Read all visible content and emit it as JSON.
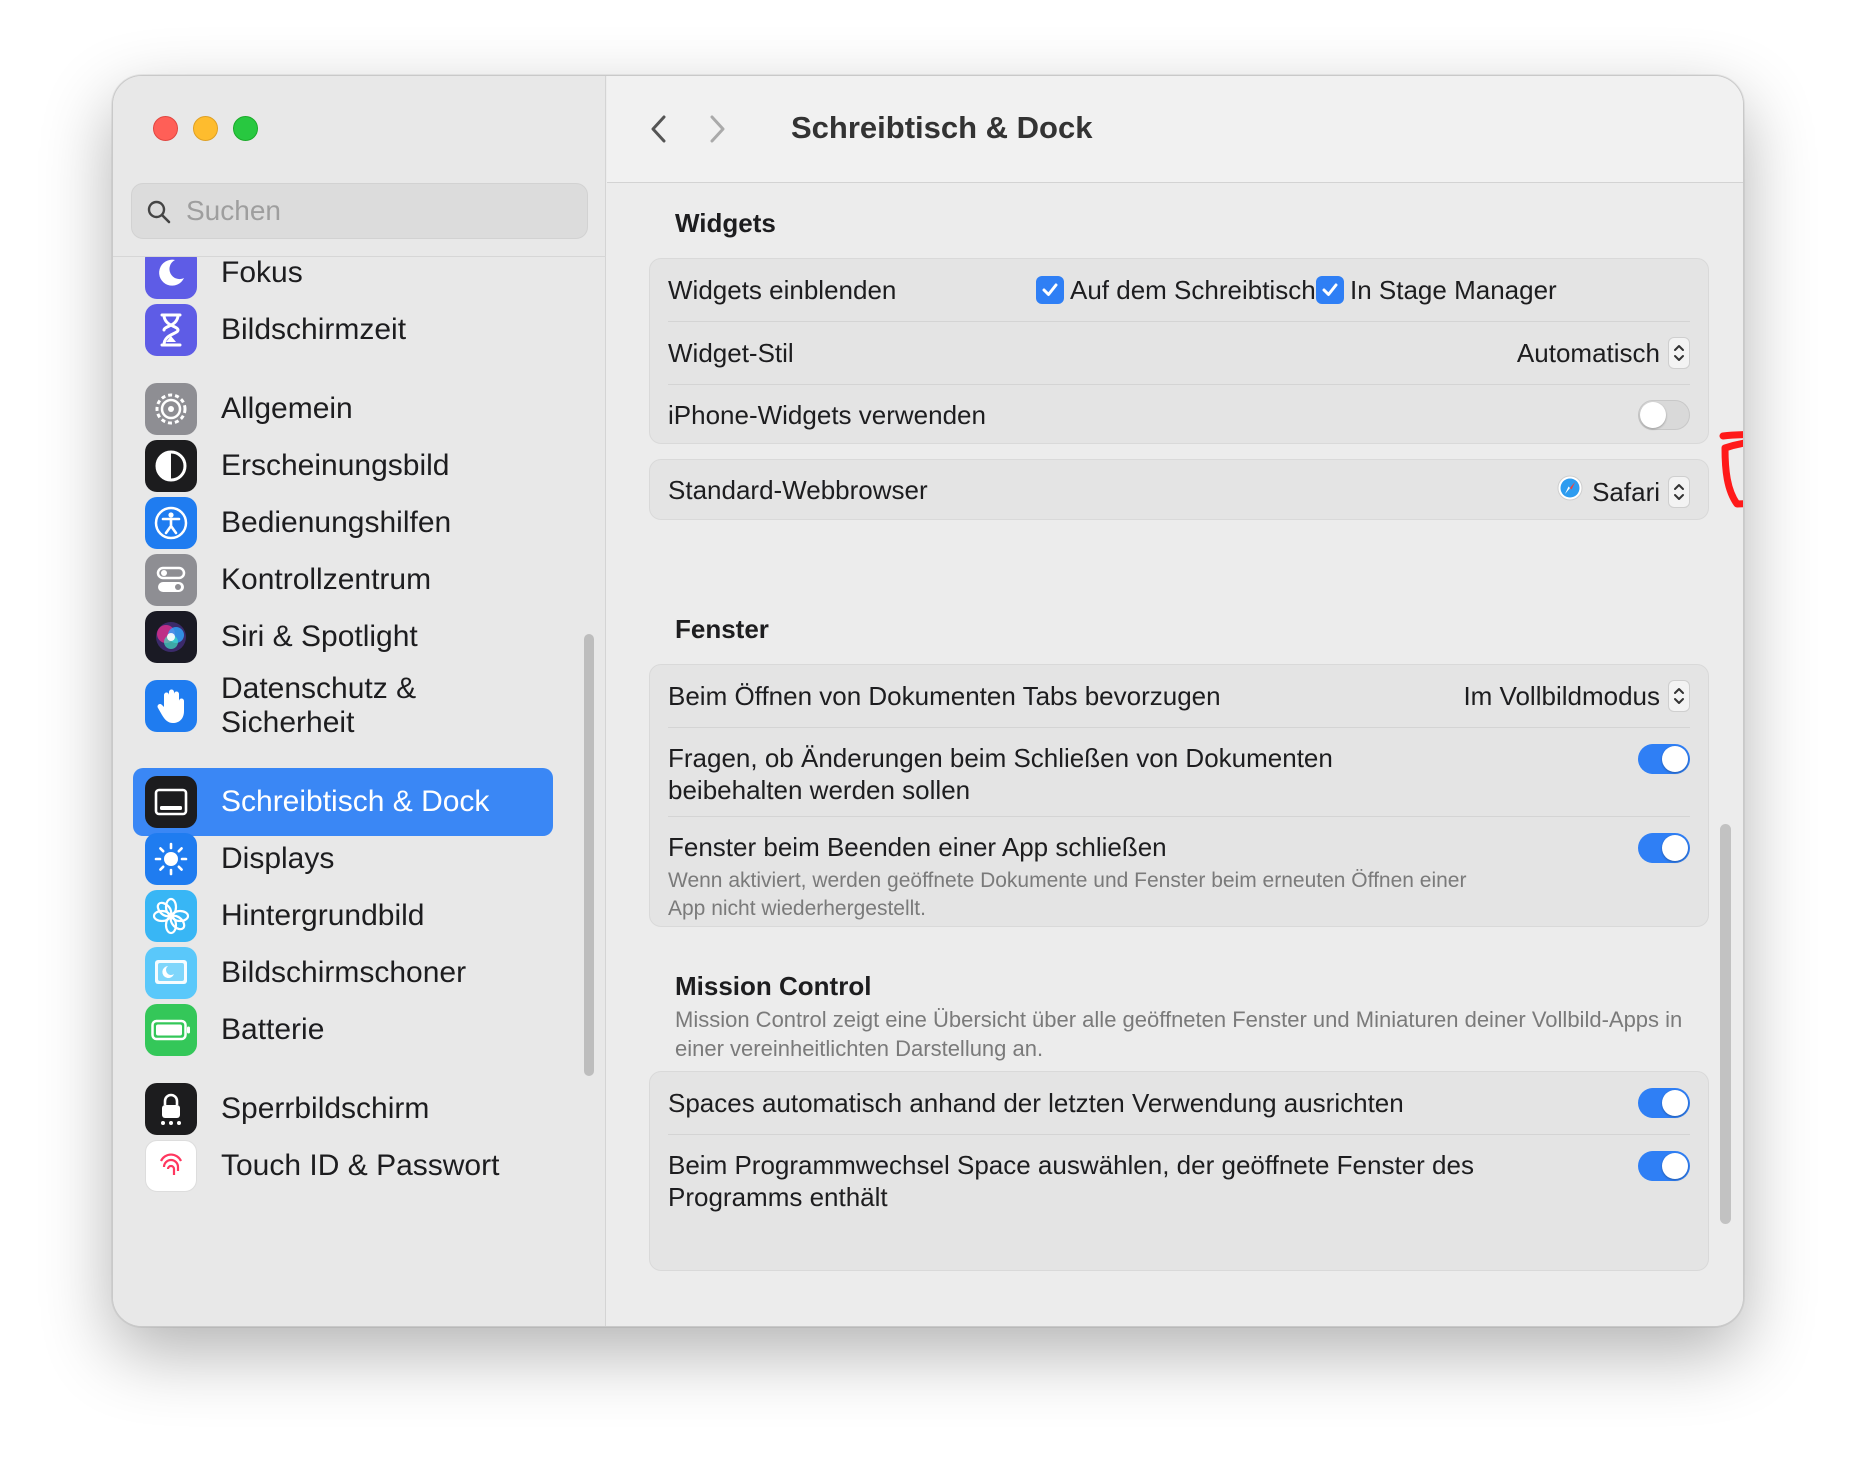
{
  "window": {
    "controls": [
      "close",
      "minimize",
      "maximize"
    ]
  },
  "sidebar": {
    "search": {
      "placeholder": "Suchen",
      "value": ""
    },
    "items": [
      {
        "label": "Fokus",
        "icon": "moon-icon",
        "color": "#5e5ce6"
      },
      {
        "label": "Bildschirmzeit",
        "icon": "hourglass-icon",
        "color": "#5e5ce6"
      },
      {
        "label": "Allgemein",
        "icon": "gear-icon",
        "color": "#8e8e93"
      },
      {
        "label": "Erscheinungsbild",
        "icon": "appearance-icon",
        "color": "#1c1c1e"
      },
      {
        "label": "Bedienungshilfen",
        "icon": "accessibility-icon",
        "color": "#1f7cf0"
      },
      {
        "label": "Kontrollzentrum",
        "icon": "control-center-icon",
        "color": "#8e8e93"
      },
      {
        "label": "Siri & Spotlight",
        "icon": "siri-icon",
        "color": "#2b2b3a"
      },
      {
        "label": "Datenschutz &\nSicherheit",
        "icon": "hand-icon",
        "color": "#1f7cf0"
      },
      {
        "label": "Schreibtisch & Dock",
        "icon": "dock-icon",
        "color": "#1c1c1e",
        "active": true
      },
      {
        "label": "Displays",
        "icon": "sun-icon",
        "color": "#1f7cf0"
      },
      {
        "label": "Hintergrundbild",
        "icon": "flower-icon",
        "color": "#38b6f5"
      },
      {
        "label": "Bildschirmschoner",
        "icon": "screensaver-icon",
        "color": "#5ac8fa"
      },
      {
        "label": "Batterie",
        "icon": "battery-icon",
        "color": "#34c759"
      },
      {
        "label": "Sperrbildschirm",
        "icon": "lock-icon",
        "color": "#1c1c1e"
      },
      {
        "label": "Touch ID & Passwort",
        "icon": "fingerprint-icon",
        "color": "#ffffff"
      }
    ]
  },
  "header": {
    "title": "Schreibtisch & Dock",
    "back_icon": "chevron-left-icon",
    "forward_icon": "chevron-right-icon"
  },
  "widgets": {
    "title": "Widgets",
    "show_label": "Widgets einblenden",
    "desktop_checkbox": {
      "label": "Auf dem Schreibtisch",
      "checked": true
    },
    "stage_checkbox": {
      "label": "In Stage Manager",
      "checked": true
    },
    "style_label": "Widget-Stil",
    "style_value": "Automatisch",
    "iphone_label": "iPhone-Widgets verwenden",
    "iphone_on": false
  },
  "browser": {
    "label": "Standard-Webbrowser",
    "value": "Safari",
    "icon": "safari-icon"
  },
  "windows": {
    "title": "Fenster",
    "tabs_label": "Beim Öffnen von Dokumenten Tabs bevorzugen",
    "tabs_value": "Im Vollbildmodus",
    "ask_label": "Fragen, ob Änderungen beim Schließen von Dokumenten beibehalten werden sollen",
    "ask_on": true,
    "close_label": "Fenster beim Beenden einer App schließen",
    "close_desc": "Wenn aktiviert, werden geöffnete Dokumente und Fenster beim erneuten Öffnen einer App nicht wiederhergestellt.",
    "close_on": true
  },
  "mission": {
    "title": "Mission Control",
    "desc": "Mission Control zeigt eine Übersicht über alle geöffneten Fenster und Miniaturen deiner Vollbild-Apps in einer vereinheitlichten Darstellung an.",
    "spaces_label": "Spaces automatisch anhand der letzten Verwendung ausrichten",
    "spaces_on": true,
    "switch_label": "Beim Programmwechsel Space auswählen, der geöffnete Fenster des Programms enthält",
    "switch_on": true
  },
  "colors": {
    "accent": "#2f7ff5",
    "sidebar_active": "#3a87f5",
    "annotation": "#ff1a1a"
  }
}
